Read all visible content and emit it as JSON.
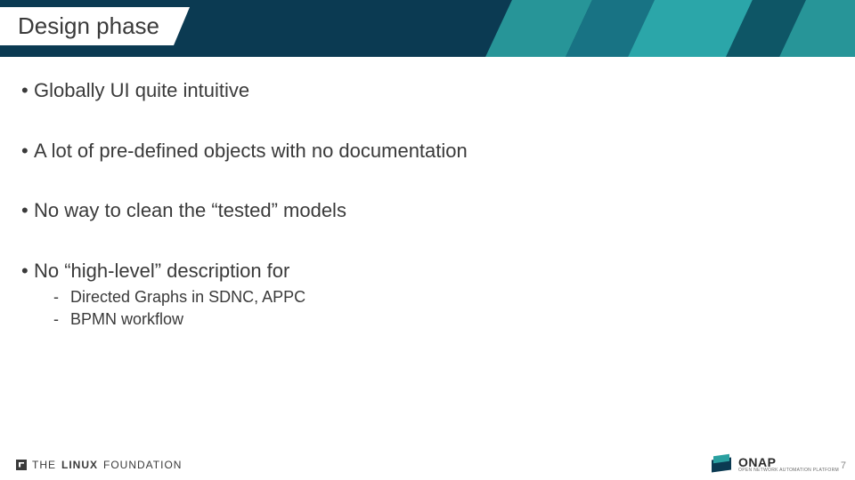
{
  "header": {
    "title": "Design phase"
  },
  "bullets": [
    {
      "text": "Globally UI quite intuitive"
    },
    {
      "text": "A lot of pre-defined objects with no documentation"
    },
    {
      "text": "No way to clean the “tested” models"
    },
    {
      "text": "No “high-level” description for",
      "sub": [
        "Directed Graphs in SDNC, APPC",
        "BPMN workflow"
      ]
    }
  ],
  "footer": {
    "left_logo": {
      "part1": "THE",
      "part2": "LINUX",
      "part3": "FOUNDATION"
    },
    "right_logo": {
      "name": "ONAP",
      "tagline": "OPEN NETWORK AUTOMATION PLATFORM"
    }
  },
  "page_number": "7"
}
